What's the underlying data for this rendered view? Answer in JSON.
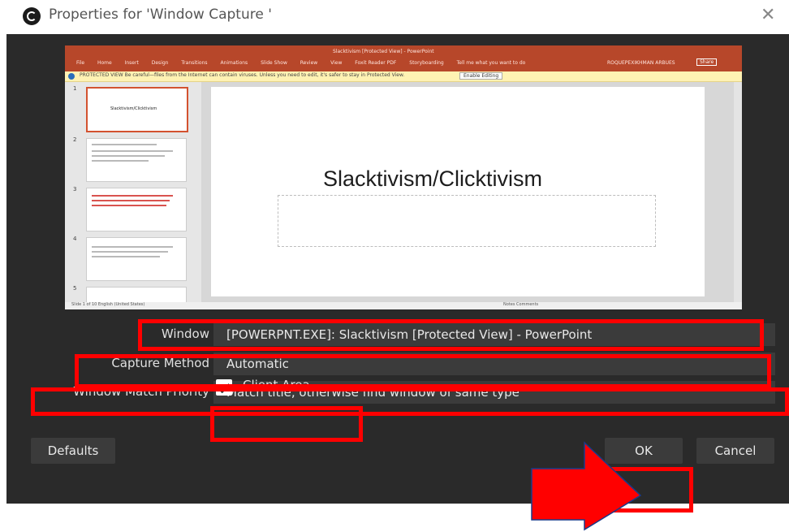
{
  "window": {
    "title": "Properties for 'Window Capture '",
    "app_icon": "obs-icon",
    "close_icon": "close-icon"
  },
  "preview": {
    "doc_title": "Slacktivism [Protected View] - PowerPoint",
    "tabs": [
      "File",
      "Home",
      "Insert",
      "Design",
      "Transitions",
      "Animations",
      "Slide Show",
      "Review",
      "View",
      "Foxit Reader PDF",
      "Storyboarding",
      "Tell me what you want to do"
    ],
    "user": "ROQUEPEXIKHMAN ARBUES",
    "share": "Share",
    "protected_text": "PROTECTED VIEW  Be careful—files from the Internet can contain viruses. Unless you need to edit, it's safer to stay in Protected View.",
    "enable_editing": "Enable Editing",
    "slide_title": "Slacktivism/Clicktivism",
    "thumb_title": "Slacktivism/Clicktivism",
    "thumb_numbers": [
      "1",
      "2",
      "3",
      "4",
      "5"
    ],
    "status_left": "Slide 1 of 10   English (United States)",
    "status_right": "Notes   Comments"
  },
  "form": {
    "window_label": "Window",
    "window_value": "[POWERPNT.EXE]: Slacktivism [Protected View] - PowerPoint",
    "capture_method_label": "Capture Method",
    "capture_method_value": "Automatic",
    "match_priority_label": "Window Match Priority",
    "match_priority_value": "Match title, otherwise find window of same type",
    "client_area_label": "Client Area",
    "client_area_checked": true
  },
  "buttons": {
    "defaults": "Defaults",
    "ok": "OK",
    "cancel": "Cancel"
  },
  "annotations": {
    "highlight_color": "#ff0000"
  }
}
